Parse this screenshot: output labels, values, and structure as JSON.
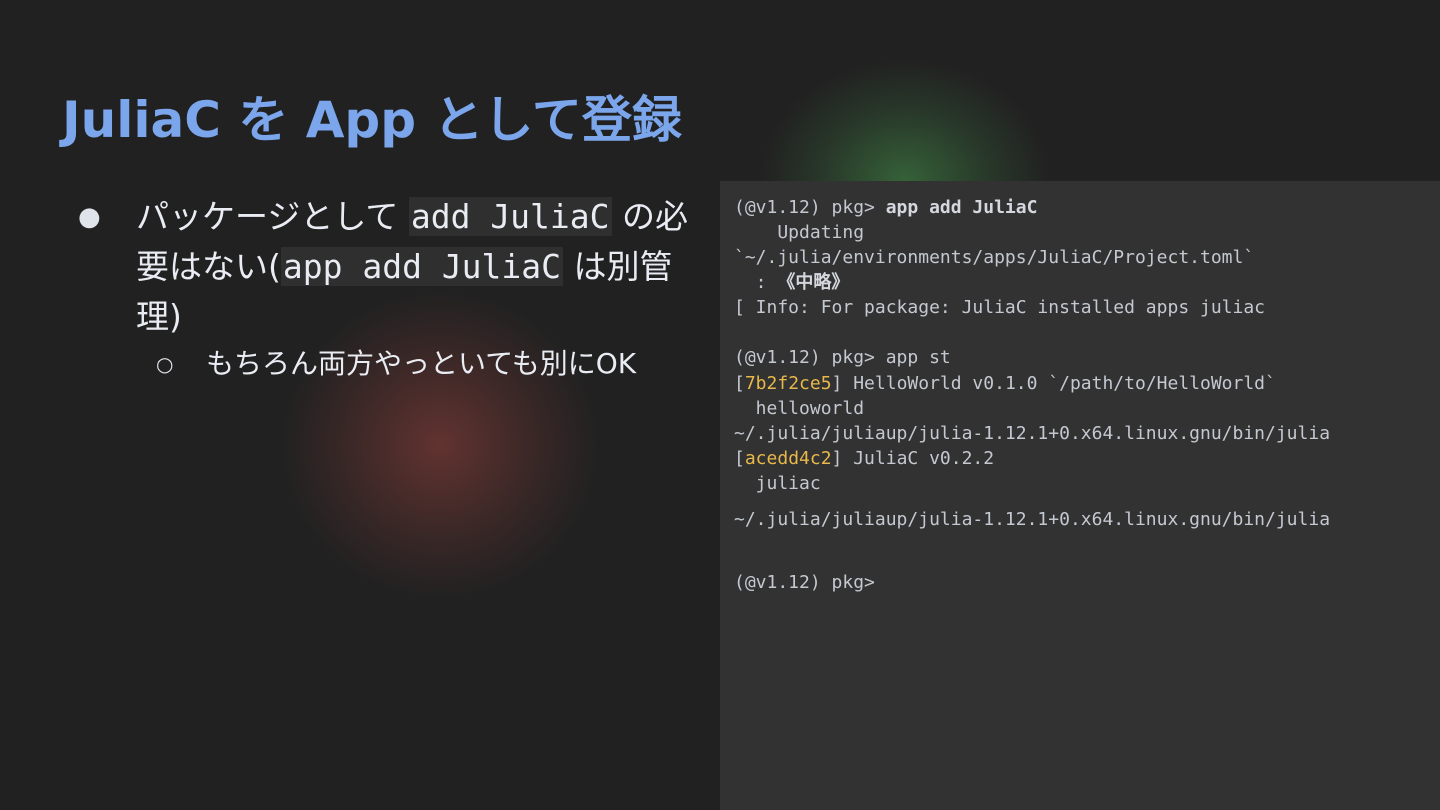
{
  "slide": {
    "title": "JuliaC を App として登録",
    "bullet1": {
      "pre": "パッケージとして ",
      "code1": "add JuliaC",
      "mid": " の必要はない(",
      "code2": "app add JuliaC",
      "post": " は別管理)"
    },
    "bullet2": "もちろん両方やっといても別にOK"
  },
  "terminal": {
    "l1_prompt": "(@v1.12) pkg> ",
    "l1_cmd": "app add JuliaC",
    "l2": "    Updating",
    "l3": "`~/.julia/environments/apps/JuliaC/Project.toml`",
    "l4_pre": "  : ",
    "l4_bold": "《中略》",
    "l5": "[ Info: For package: JuliaC installed apps juliac",
    "l6": "(@v1.12) pkg> app st",
    "l7_open": "[",
    "l7_hash": "7b2f2ce5",
    "l7_rest": "] HelloWorld v0.1.0 `/path/to/HelloWorld`",
    "l8": "  helloworld",
    "l9": "~/.julia/juliaup/julia-1.12.1+0.x64.linux.gnu/bin/julia",
    "l10_open": "[",
    "l10_hash": "acedd4c2",
    "l10_rest": "] JuliaC v0.2.2",
    "l11": "  juliac",
    "l12": "~/.julia/juliaup/julia-1.12.1+0.x64.linux.gnu/bin/julia",
    "l13": "(@v1.12) pkg>"
  },
  "colors": {
    "title": "#7ba6ec",
    "hash": "#e8b94a",
    "background": "#212121",
    "terminal_bg": "#323232"
  }
}
